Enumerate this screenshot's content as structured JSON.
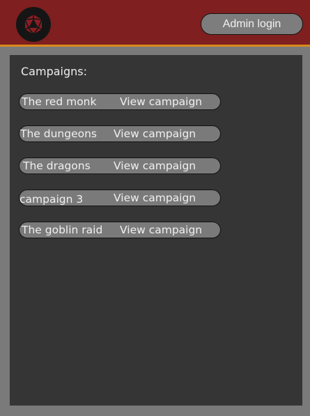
{
  "header": {
    "logo_icon": "d20-die-icon",
    "admin_login_label": "Admin login"
  },
  "main": {
    "title": "Campaigns:",
    "view_label": "View campaign",
    "campaigns": [
      {
        "name": "The red monk"
      },
      {
        "name": "The dungeons"
      },
      {
        "name": "The dragons"
      },
      {
        "name": "campaign 3"
      },
      {
        "name": "The goblin raid"
      }
    ]
  },
  "colors": {
    "header_bg": "#7f1f1f",
    "header_accent": "#d98a1e",
    "panel_bg": "#353535",
    "page_bg": "#7a7a7a",
    "pill_bg": "#7a7a7a"
  }
}
